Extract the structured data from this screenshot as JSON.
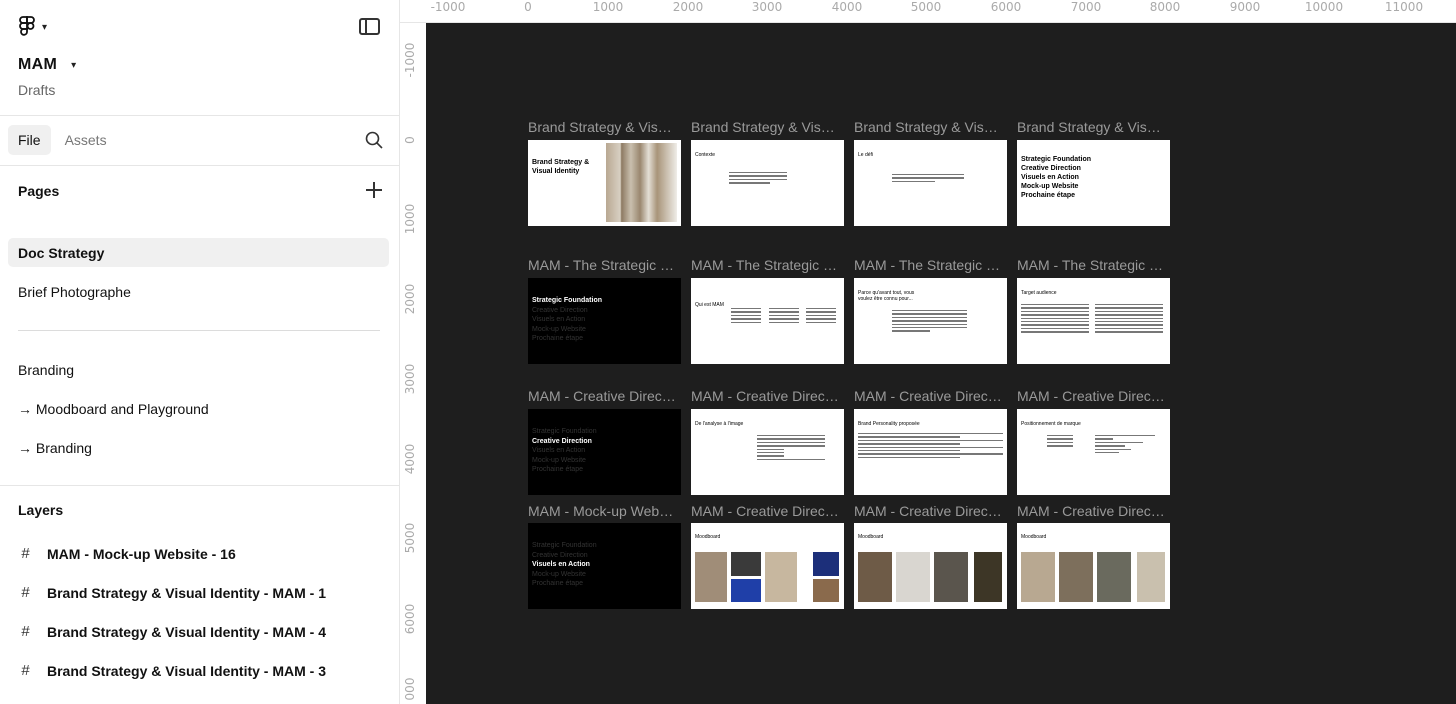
{
  "sidebar": {
    "project_name": "MAM",
    "project_location": "Drafts",
    "tabs": [
      {
        "label": "File"
      },
      {
        "label": "Assets"
      }
    ],
    "pages_title": "Pages",
    "pages": [
      {
        "label": "Doc Strategy"
      },
      {
        "label": "Brief Photographe"
      },
      {
        "label": "Branding"
      },
      {
        "label": "→ Moodboard and Playground"
      },
      {
        "label": "→ Branding"
      }
    ],
    "layers_title": "Layers",
    "layers": [
      {
        "label": "MAM - Mock-up Website - 16"
      },
      {
        "label": "Brand Strategy & Visual Identity - MAM - 1"
      },
      {
        "label": "Brand Strategy & Visual Identity - MAM - 4"
      },
      {
        "label": "Brand Strategy & Visual Identity - MAM - 3"
      }
    ]
  },
  "ruler": {
    "x_ticks": [
      "-1000",
      "0",
      "1000",
      "2000",
      "3000",
      "4000",
      "5000",
      "6000",
      "7000",
      "8000",
      "9000",
      "10000",
      "11000"
    ],
    "y_ticks": [
      "-1000",
      "0",
      "1000",
      "2000",
      "3000",
      "4000",
      "5000",
      "6000",
      "000"
    ]
  },
  "canvas": {
    "background": "#1e1e1e",
    "labels": {
      "brand": "Brand Strategy & Visual Identity",
      "strategic": "MAM - The Strategic Foundation",
      "creative": "MAM - Creative Direction",
      "mockup": "MAM - Mock-up Website"
    },
    "slides": {
      "cover_title": "Brand Strategy & Visual Identity",
      "contexte": "Contexte",
      "defi": "Le défi",
      "menu": [
        "Strategic Foundation",
        "Creative Direction",
        "Visuels en Action",
        "Mock-up Website",
        "Prochaine étape"
      ],
      "qui_est": "Qui est MAM",
      "vous_voulez": "Parce qu'avant tout, vous voulez être connu pour...",
      "target": "Target audience",
      "analyse": "De l'analyse à l'image",
      "personality": "Brand Personality proposée",
      "positionnement": "Positionnement de marque",
      "moodboard": "Moodboard"
    }
  }
}
